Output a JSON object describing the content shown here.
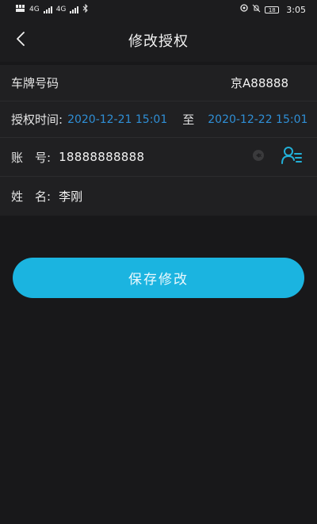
{
  "status_bar": {
    "sim1": "4G",
    "sim2": "4G",
    "battery": "18",
    "time": "3:05"
  },
  "header": {
    "title": "修改授权"
  },
  "form": {
    "plate": {
      "label": "车牌号码",
      "value": "京A88888"
    },
    "auth_time": {
      "label": "授权时间:",
      "start": "2020-12-21 15:01",
      "separator": "至",
      "end": "2020-12-22 15:01"
    },
    "account": {
      "label": "账　号:",
      "value": "18888888888"
    },
    "name": {
      "label": "姓　名:",
      "value": "李刚"
    }
  },
  "save_button": {
    "label": "保存修改"
  },
  "colors": {
    "accent": "#1bb4e0",
    "time_text": "#2f8fd6",
    "background": "#18181a",
    "card": "#202022"
  },
  "icons": {
    "back": "chevron-left-icon",
    "clear": "clear-circle-icon",
    "contact": "contact-list-icon"
  }
}
